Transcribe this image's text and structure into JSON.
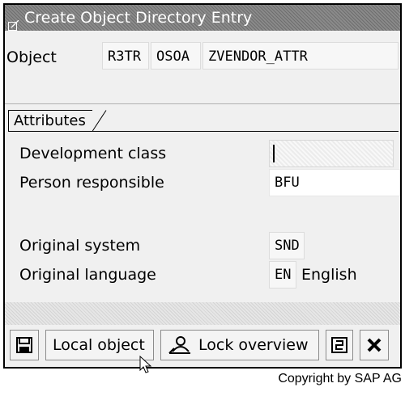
{
  "window": {
    "title": "Create Object Directory Entry"
  },
  "object": {
    "label": "Object",
    "program_id": "R3TR",
    "object_type": "OSOA",
    "object_name": "ZVENDOR_ATTR"
  },
  "attributes": {
    "tab_label": "Attributes",
    "development_class": {
      "label": "Development class",
      "value": ""
    },
    "person_responsible": {
      "label": "Person responsible",
      "value": "BFU"
    },
    "original_system": {
      "label": "Original system",
      "value": "SND"
    },
    "original_language": {
      "label": "Original language",
      "code": "EN",
      "name": "English"
    }
  },
  "toolbar": {
    "save_icon": "save-icon",
    "local_object_label": "Local object",
    "lock_overview_label": "Lock overview",
    "lock_overview_icon": "person-icon",
    "tree_icon": "hierarchy-icon",
    "cancel_icon": "cancel-icon"
  },
  "footer": {
    "copyright": "Copyright by SAP AG"
  }
}
